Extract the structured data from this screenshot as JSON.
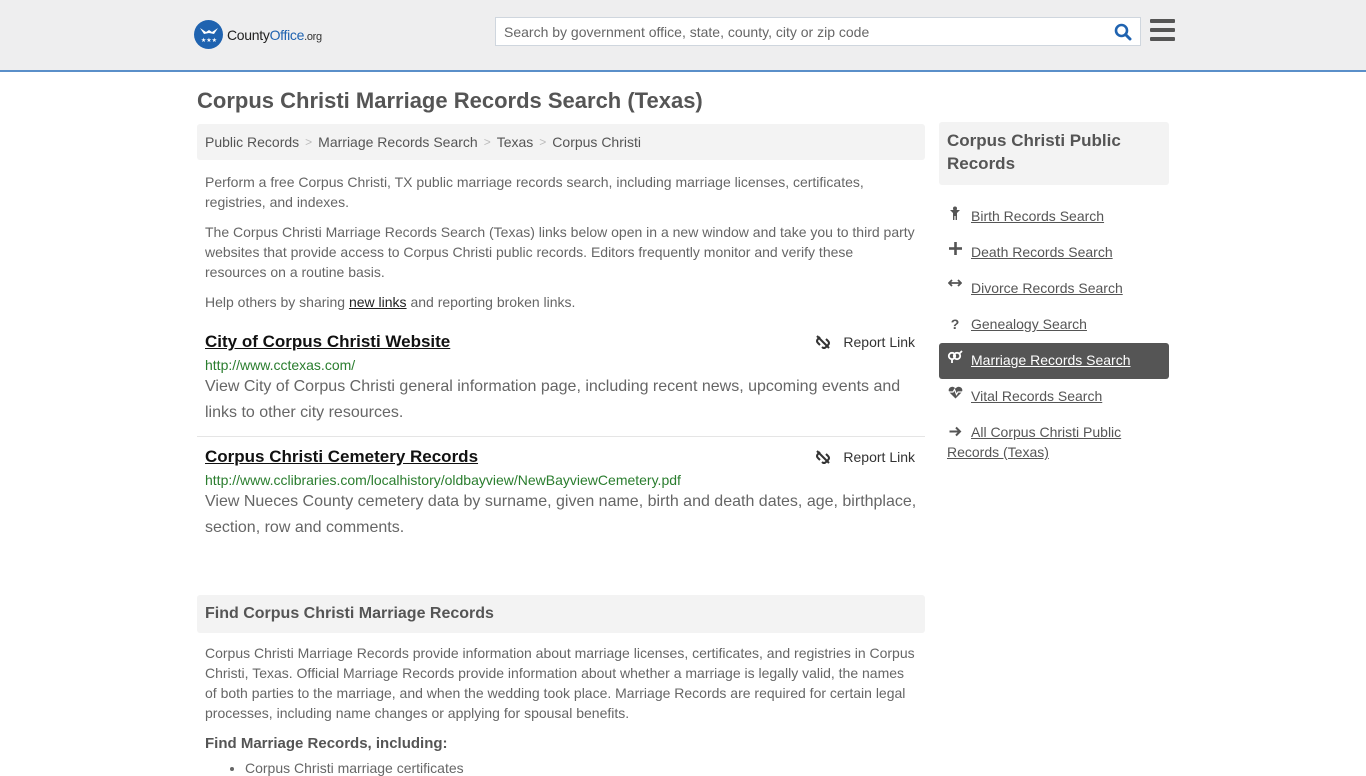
{
  "header": {
    "logo": {
      "county": "County",
      "office": "Office",
      "tld": ".org"
    },
    "search": {
      "placeholder": "Search by government office, state, county, city or zip code",
      "value": ""
    }
  },
  "page_title": "Corpus Christi Marriage Records Search (Texas)",
  "breadcrumb": [
    "Public Records",
    "Marriage Records Search",
    "Texas",
    "Corpus Christi"
  ],
  "intro": {
    "p1": "Perform a free Corpus Christi, TX public marriage records search, including marriage licenses, certificates, registries, and indexes.",
    "p2": "The Corpus Christi Marriage Records Search (Texas) links below open in a new window and take you to third party websites that provide access to Corpus Christi public records. Editors frequently monitor and verify these resources on a routine basis.",
    "p3_before": "Help others by sharing ",
    "p3_link": "new links",
    "p3_after": " and reporting broken links."
  },
  "results": [
    {
      "title": "City of Corpus Christi Website",
      "url": "http://www.cctexas.com/",
      "description": "View City of Corpus Christi general information page, including recent news, upcoming events and links to other city resources.",
      "report_label": "Report Link"
    },
    {
      "title": "Corpus Christi Cemetery Records",
      "url": "http://www.cclibraries.com/localhistory/oldbayview/NewBayviewCemetery.pdf",
      "description": "View Nueces County cemetery data by surname, given name, birth and death dates, age, birthplace, section, row and comments.",
      "report_label": "Report Link"
    }
  ],
  "find_section": {
    "heading": "Find Corpus Christi Marriage Records",
    "body": "Corpus Christi Marriage Records provide information about marriage licenses, certificates, and registries in Corpus Christi, Texas. Official Marriage Records provide information about whether a marriage is legally valid, the names of both parties to the marriage, and when the wedding took place. Marriage Records are required for certain legal processes, including name changes or applying for spousal benefits.",
    "subheading": "Find Marriage Records, including:",
    "items": [
      "Corpus Christi marriage certificates"
    ]
  },
  "sidebar": {
    "heading": "Corpus Christi Public Records",
    "items": [
      {
        "label": "Birth Records Search",
        "icon": "child-icon",
        "active": false
      },
      {
        "label": "Death Records Search",
        "icon": "plus-icon",
        "active": false
      },
      {
        "label": "Divorce Records Search",
        "icon": "arrows-horizontal-icon",
        "active": false
      },
      {
        "label": "Genealogy Search",
        "icon": "question-icon",
        "active": false
      },
      {
        "label": "Marriage Records Search",
        "icon": "intersex-icon",
        "active": true
      },
      {
        "label": "Vital Records Search",
        "icon": "heartbeat-icon",
        "active": false
      },
      {
        "label": "All Corpus Christi Public Records (Texas)",
        "icon": "arrow-right-icon",
        "active": false
      }
    ]
  },
  "colors": {
    "brand_blue": "#1f63b0",
    "url_green": "#2a7d2e",
    "active_bg": "#555555",
    "header_bg": "#eeeeef"
  }
}
